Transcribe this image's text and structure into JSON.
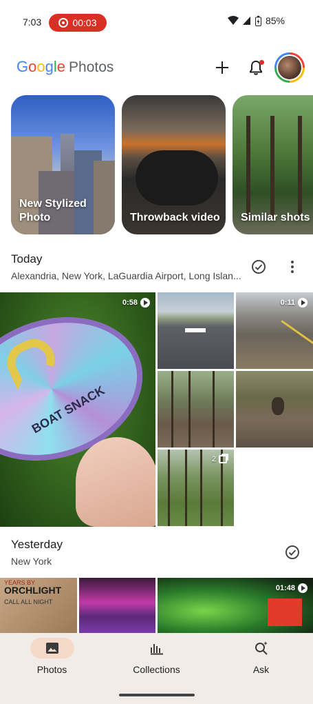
{
  "status_bar": {
    "time": "7:03",
    "recording": "00:03",
    "battery": "85%"
  },
  "header": {
    "logo_google": [
      "G",
      "o",
      "o",
      "g",
      "l",
      "e"
    ],
    "logo_photos": "Photos"
  },
  "memories": [
    {
      "label": "New Stylized Photo"
    },
    {
      "label": "Throwback video"
    },
    {
      "label": "Similar shots"
    }
  ],
  "today": {
    "title": "Today",
    "subtitle": "Alexandria, New York, LaGuardia Airport, Long Islan...",
    "tiles": {
      "frisbee_duration": "0:58",
      "frisbee_text": "BOAT SNACK",
      "tracks_duration": "0:11",
      "woods_stack_count": "2"
    }
  },
  "yesterday": {
    "title": "Yesterday",
    "subtitle": "New York",
    "tiles": {
      "book_text": "ORCHLIGHT",
      "book_top": "YEARS BY",
      "book_sub": "CALL ALL NIGHT",
      "party_duration": "01:48"
    }
  },
  "bottom_nav": {
    "items": [
      {
        "label": "Photos",
        "icon": "photo-icon",
        "active": true
      },
      {
        "label": "Collections",
        "icon": "collections-icon",
        "active": false
      },
      {
        "label": "Ask",
        "icon": "ask-search-icon",
        "active": false
      }
    ]
  },
  "colors": {
    "recording_red": "#d93025",
    "nav_background": "#f1ece8",
    "nav_active_pill": "#f6dac9"
  }
}
